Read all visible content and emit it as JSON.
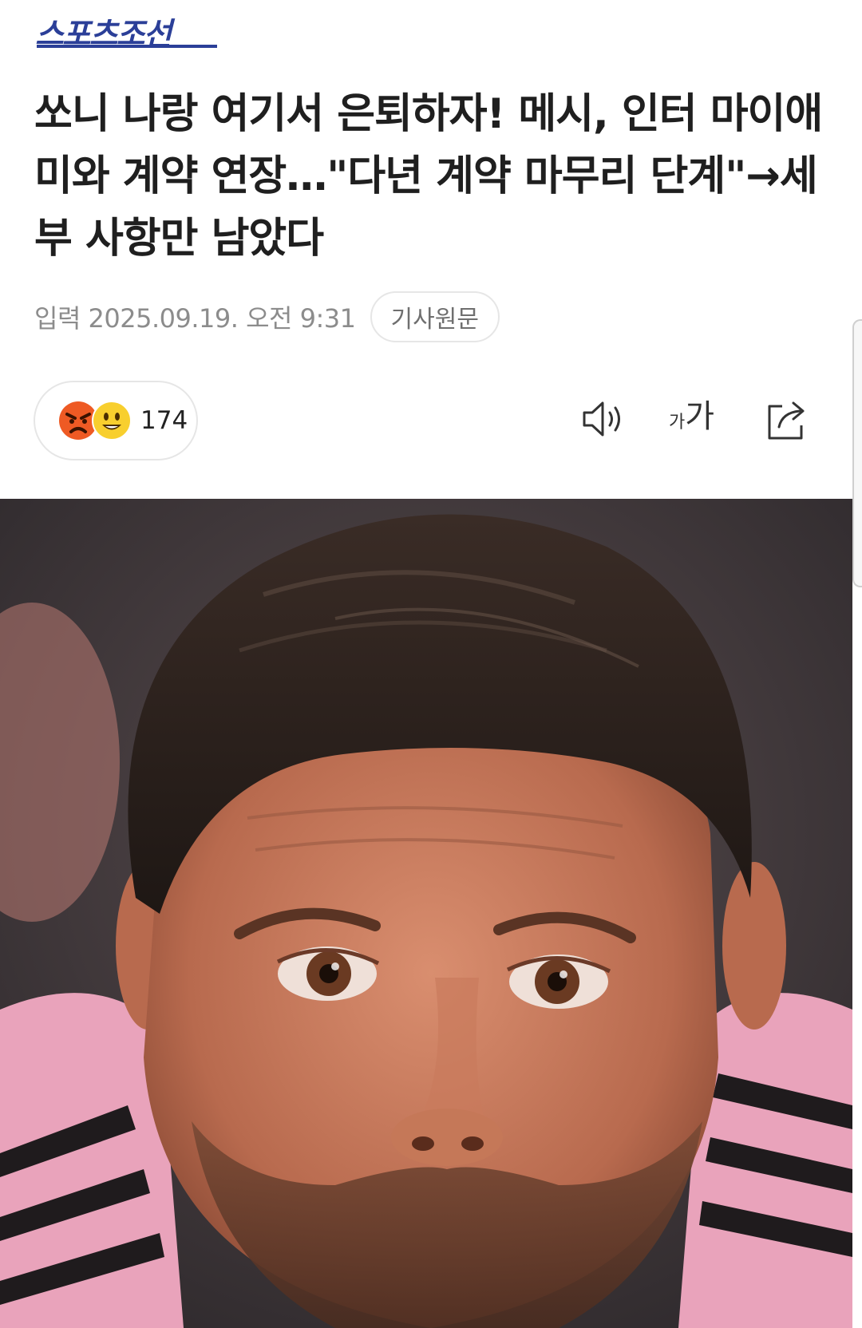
{
  "brand": {
    "name": "스포츠조선",
    "color": "#2b3f98"
  },
  "article": {
    "title": "쏘니 나랑 여기서 은퇴하자! 메시, 인터 마이애미와 계약 연장…\"다년 계약 마무리 단계\"→세부 사항만 남았다",
    "date": "입력 2025.09.19. 오전 9:31",
    "source_button": "기사원문"
  },
  "reactions": {
    "icons": [
      "angry-face-icon",
      "grinning-face-icon"
    ],
    "count": "174"
  },
  "toolbar": {
    "speaker_icon": "speaker-icon",
    "font_small": "가",
    "font_big": "가",
    "share_icon": "share-icon"
  },
  "photo": {
    "description_icon": "hero-photo",
    "jersey_color": "#e9a3bb"
  }
}
